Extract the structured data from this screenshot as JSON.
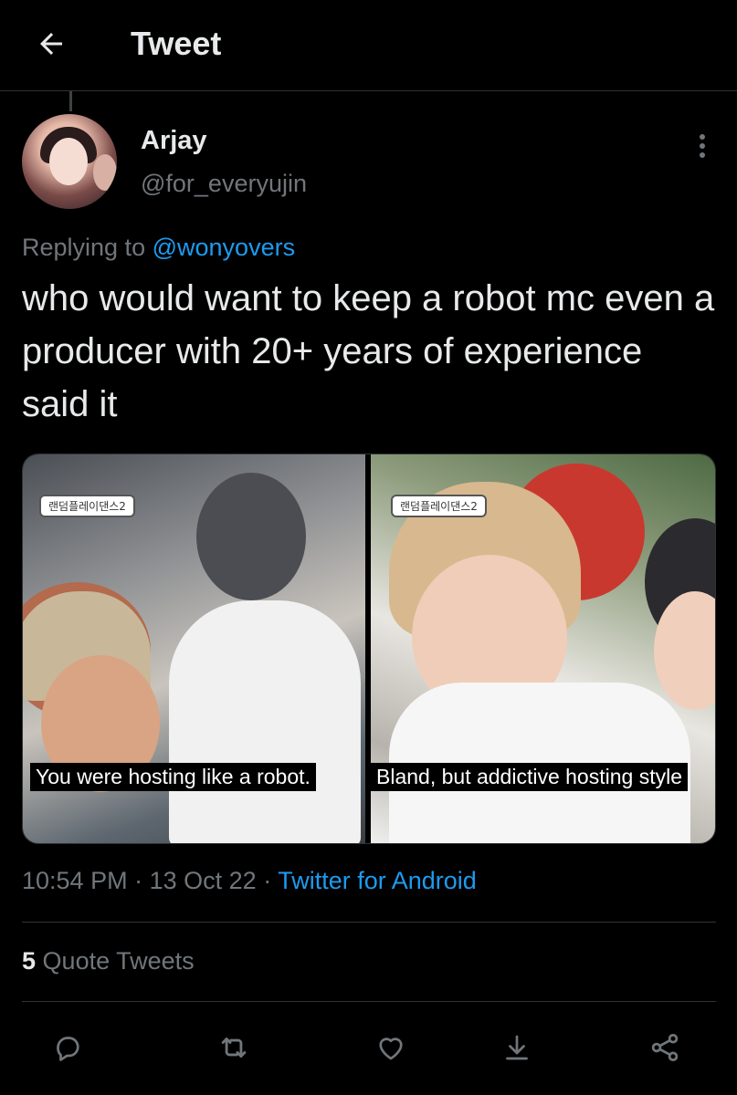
{
  "header": {
    "title": "Tweet",
    "back_icon": "arrow-left-icon"
  },
  "author": {
    "name": "Arjay",
    "handle": "@for_everyujin"
  },
  "reply": {
    "prefix": "Replying to",
    "target": "@wonyovers"
  },
  "tweet": {
    "text": "who would want to keep a robot mc even a producer with 20+ years of experience said it"
  },
  "media": [
    {
      "badge": "랜덤플레이댄스2",
      "caption": "You were hosting like a robot."
    },
    {
      "badge": "랜덤플레이댄스2",
      "caption": "Bland, but addictive hosting style"
    }
  ],
  "meta": {
    "time": "10:54 PM",
    "date": "13 Oct 22",
    "separator": "·",
    "source": "Twitter for Android"
  },
  "stats": {
    "quote_count": "5",
    "quote_label": "Quote Tweets"
  },
  "actions": {
    "icons": [
      "reply-icon",
      "retweet-icon",
      "like-icon",
      "bookmark-icon",
      "share-icon"
    ]
  },
  "colors": {
    "background": "#000000",
    "text": "#e7e9ea",
    "secondary": "#71767b",
    "accent": "#1d9bf0",
    "divider": "#2f3336"
  }
}
